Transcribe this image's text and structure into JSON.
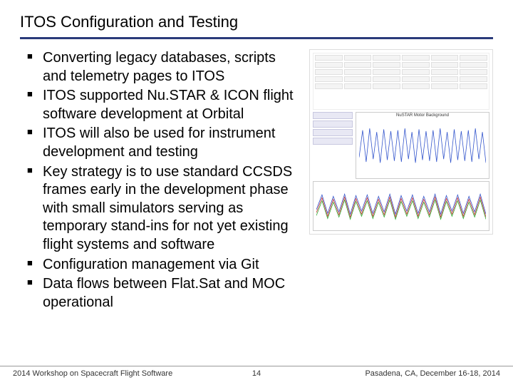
{
  "slide": {
    "title": "ITOS Configuration and Testing",
    "bullets": [
      "Converting legacy databases, scripts and telemetry pages to ITOS",
      "ITOS supported Nu.STAR & ICON flight software development at Orbital",
      "ITOS will also be used for instrument development and testing",
      "Key strategy is to use standard CCSDS frames early in the development phase with small simulators serving as temporary stand-ins for not yet existing flight systems and software",
      "Configuration management via Git",
      "Data flows between Flat.Sat and MOC operational"
    ],
    "figure": {
      "plot_title": "NuSTAR Motor Background"
    },
    "footer": {
      "left": "2014 Workshop on Spacecraft Flight Software",
      "page": "14",
      "right": "Pasadena, CA, December 16-18, 2014"
    }
  }
}
